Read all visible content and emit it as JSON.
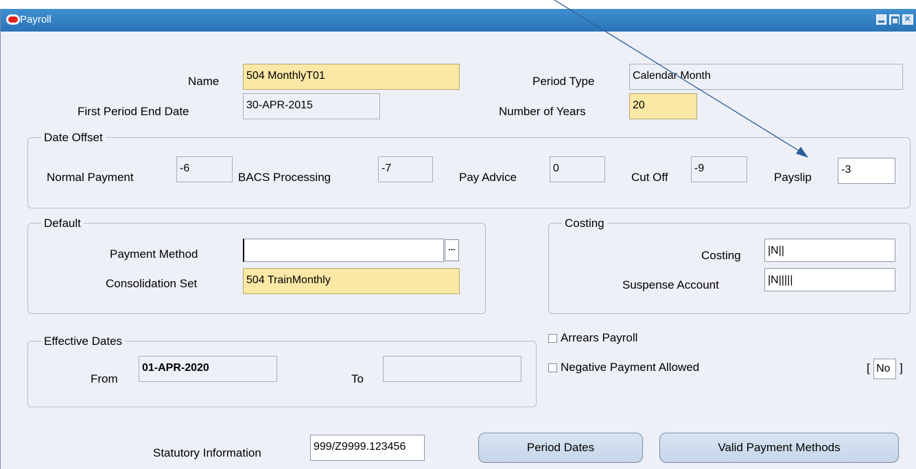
{
  "window": {
    "title": "Payroll"
  },
  "form": {
    "name_label": "Name",
    "name_value": "504 MonthlyT01",
    "period_type_label": "Period Type",
    "period_type_value": "Calendar Month",
    "first_period_end_label": "First Period End Date",
    "first_period_end_value": "30-APR-2015",
    "number_of_years_label": "Number of Years",
    "number_of_years_value": "20"
  },
  "date_offset": {
    "title": "Date Offset",
    "normal_payment_label": "Normal Payment",
    "normal_payment_value": "-6",
    "bacs_label": "BACS Processing",
    "bacs_value": "-7",
    "pay_advice_label": "Pay Advice",
    "pay_advice_value": "0",
    "cut_off_label": "Cut Off",
    "cut_off_value": "-9",
    "payslip_label": "Payslip",
    "payslip_value": "-3"
  },
  "default": {
    "title": "Default",
    "payment_method_label": "Payment Method",
    "payment_method_value": "",
    "lov_label": "...",
    "consolidation_label": "Consolidation Set",
    "consolidation_value": "504 TrainMonthly"
  },
  "costing": {
    "title": "Costing",
    "costing_label": "Costing",
    "costing_value": "|N||",
    "suspense_label": "Suspense Account",
    "suspense_value": "|N|||||"
  },
  "effective_dates": {
    "title": "Effective Dates",
    "from_label": "From",
    "from_value": "01-APR-2020",
    "to_label": "To",
    "to_value": ""
  },
  "options": {
    "arrears_label": "Arrears Payroll",
    "negative_label": "Negative Payment Allowed",
    "bracket_open": "[",
    "negative_value": "No",
    "bracket_close": "]"
  },
  "footer": {
    "statutory_label": "Statutory Information",
    "statutory_value": "999/Z9999.123456",
    "period_dates_button": "Period Dates",
    "valid_payment_methods_button": "Valid Payment Methods"
  },
  "annotation": {
    "arrow_color": "#2f5d9a"
  }
}
